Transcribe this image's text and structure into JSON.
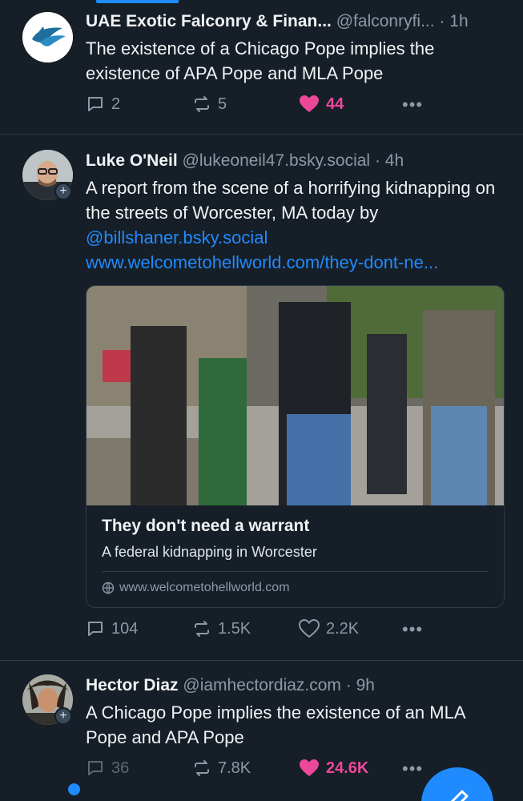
{
  "posts": [
    {
      "author": "UAE Exotic Falconry & Finan...",
      "handle": "@falconryfi...",
      "time": "1h",
      "text": "The existence of a Chicago Pope implies the existence of APA Pope and MLA Pope",
      "replies": "2",
      "reposts": "5",
      "likes": "44",
      "liked": true
    },
    {
      "author": "Luke O'Neil",
      "handle": "@lukeoneil47.bsky.social",
      "time": "4h",
      "text_before": "A report from the scene of a horrifying kidnapping on the streets of Worcester, MA today by ",
      "mention": "@billshaner.bsky.social",
      "url_text": "www.welcometohellworld.com/they-dont-ne...",
      "card": {
        "title": "They don't need a warrant",
        "description": "A federal kidnapping in Worcester",
        "domain": "www.welcometohellworld.com"
      },
      "replies": "104",
      "reposts": "1.5K",
      "likes": "2.2K",
      "liked": false
    },
    {
      "author": "Hector Diaz",
      "handle": "@iamhectordiaz.com",
      "time": "9h",
      "text": "A Chicago Pope implies the existence of an MLA Pope and APA Pope",
      "replies": "36",
      "reposts": "7.8K",
      "likes": "24.6K",
      "liked": true
    }
  ],
  "colors": {
    "background": "#161e27",
    "accent": "#208bfe",
    "like": "#ec4899",
    "muted": "#8d99a6"
  }
}
